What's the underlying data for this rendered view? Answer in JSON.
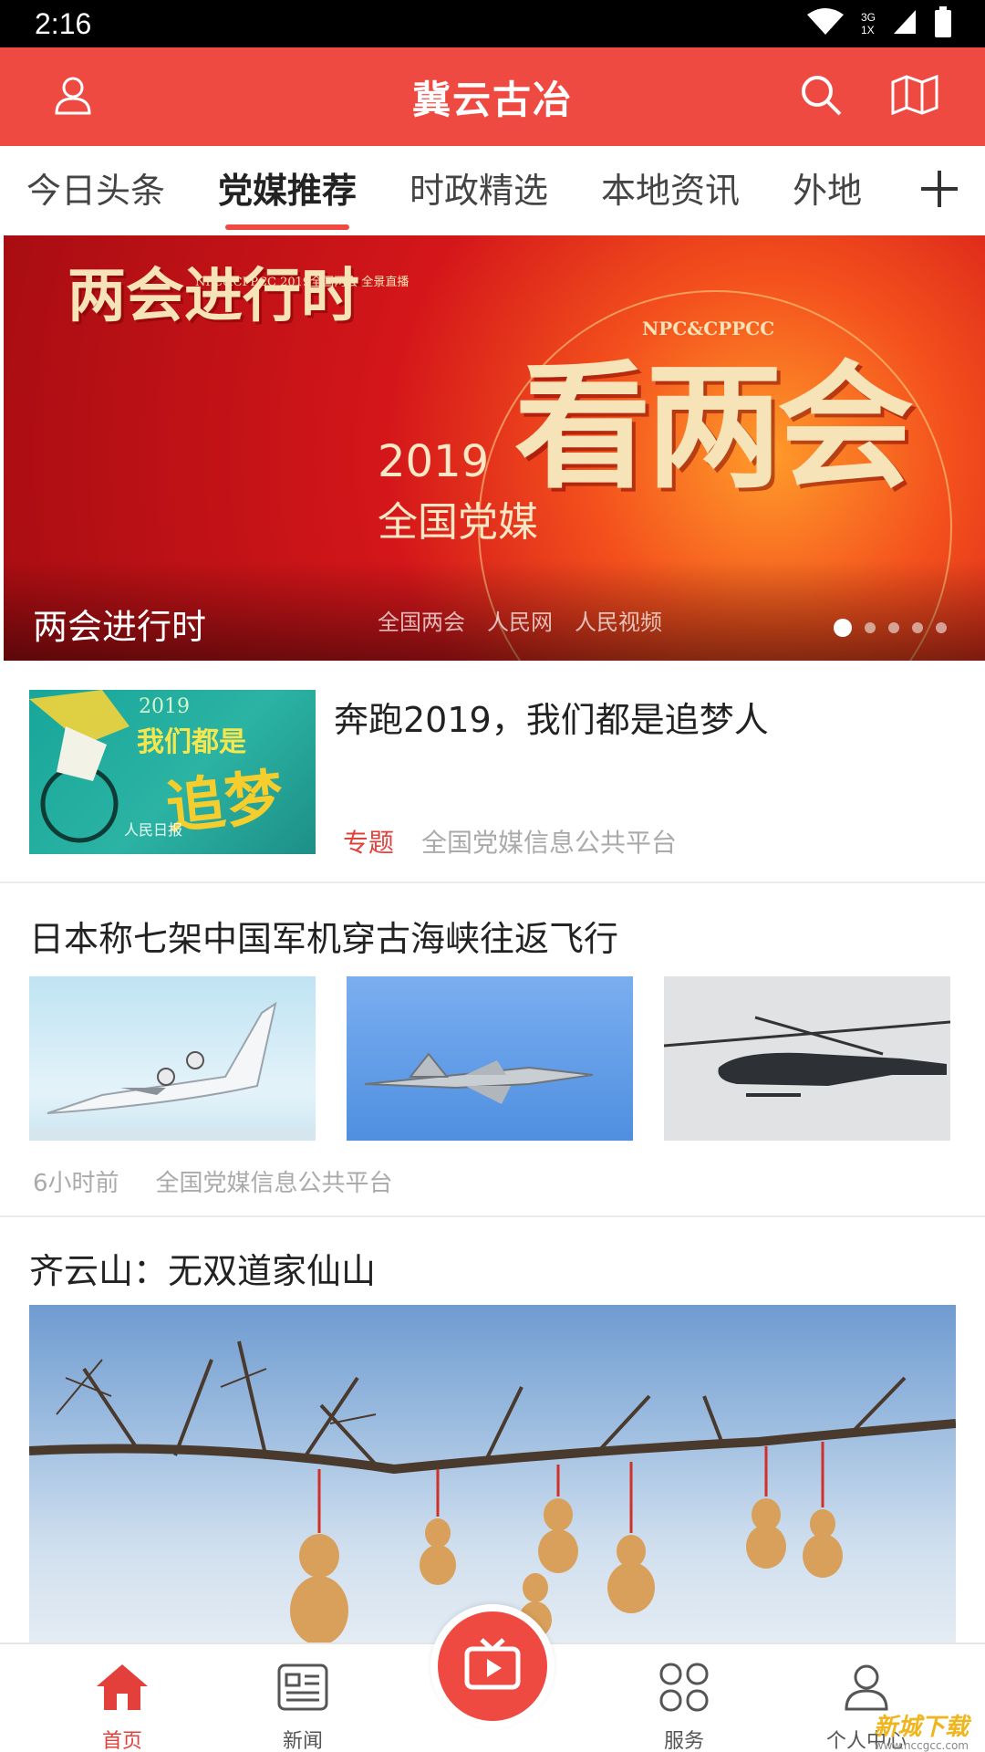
{
  "status_bar": {
    "time": "2:16",
    "network_top": "3G",
    "network_bottom": "1X"
  },
  "header": {
    "title": "冀云古冶",
    "icons": [
      "user-icon",
      "search-icon",
      "map-icon"
    ]
  },
  "tabs": {
    "items": [
      "今日头条",
      "党媒推荐",
      "时政精选",
      "本地资讯",
      "外地"
    ],
    "active_index": 1,
    "add_icon": "plus-icon"
  },
  "banner": {
    "caption": "两会进行时",
    "calligraphy_small": "两会进行时",
    "calligraphy_big": "看两会",
    "org": "NPC&CPPCC",
    "org_small": "NPC&CPPCC 2019全国两会 全景直播",
    "year": "2019",
    "media": "全国党媒",
    "logos": [
      "全国两会",
      "人民网",
      "人民视频"
    ],
    "dot_count": 5,
    "active_dot": 0
  },
  "articles": [
    {
      "title": "奔跑2019，我们都是追梦人",
      "tag": "专题",
      "source": "全国党媒信息公共平台",
      "thumb": {
        "year": "2019",
        "line1": "我们都是",
        "line2": "追梦",
        "source": "人民日报"
      }
    },
    {
      "title": "日本称七架中国军机穿古海峡往返飞行",
      "time": "6小时前",
      "source": "全国党媒信息公共平台"
    },
    {
      "title": "齐云山：无双道家仙山"
    }
  ],
  "bottom_nav": {
    "items": [
      {
        "label": "首页",
        "icon": "home-icon"
      },
      {
        "label": "新闻",
        "icon": "news-icon"
      },
      {
        "label": "服务",
        "icon": "services-icon"
      },
      {
        "label": "个人中心",
        "icon": "profile-icon"
      }
    ],
    "active_index": 0,
    "center_icon": "tv-play-icon"
  },
  "watermark": {
    "name": "新城下载",
    "url": "www.nccgcc.com"
  },
  "colors": {
    "brand_red": "#ee4a42",
    "tag_red": "#e4403b",
    "meta_gray": "#aaaaaa"
  }
}
